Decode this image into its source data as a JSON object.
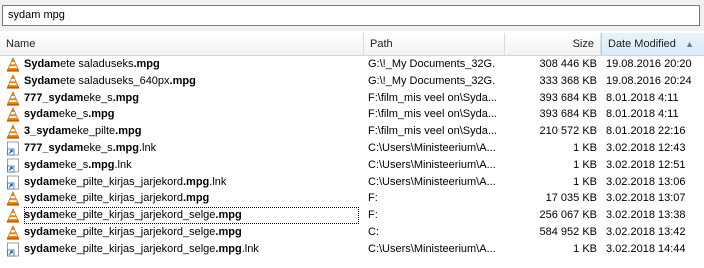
{
  "search": {
    "value": "sydam mpg"
  },
  "columns": {
    "name": "Name",
    "path": "Path",
    "size": "Size",
    "date": "Date Modified"
  },
  "rows": [
    {
      "bold": "Sydam",
      "rest": "ete saladuseks",
      "bold2": ".mpg",
      "tail": "",
      "path": "G:\\!_My Documents_32G...",
      "size": "308 446 KB",
      "date": "19.08.2016 20:20",
      "icon": "vlc-cone-icon"
    },
    {
      "bold": "Sydam",
      "rest": "ete saladuseks_640px",
      "bold2": ".mpg",
      "tail": "",
      "path": "G:\\!_My Documents_32G...",
      "size": "333 368 KB",
      "date": "19.08.2016 20:24",
      "icon": "vlc-cone-icon"
    },
    {
      "bold": "777_sydam",
      "rest": "eke_s",
      "bold2": ".mpg",
      "tail": "",
      "path": "F:\\film_mis veel on\\Syda...",
      "size": "393 684 KB",
      "date": "8.01.2018 4:11",
      "icon": "vlc-cone-icon"
    },
    {
      "bold": "sydam",
      "rest": "eke_s",
      "bold2": ".mpg",
      "tail": "",
      "path": "F:\\film_mis veel on\\Syda...",
      "size": "393 684 KB",
      "date": "8.01.2018 4:11",
      "icon": "vlc-cone-icon"
    },
    {
      "bold": "3_sydam",
      "rest": "eke_pilte",
      "bold2": ".mpg",
      "tail": "",
      "path": "F:\\film_mis veel on\\Syda...",
      "size": "210 572 KB",
      "date": "8.01.2018 22:16",
      "icon": "vlc-cone-icon"
    },
    {
      "bold": "777_sydam",
      "rest": "eke_s",
      "bold2": ".mpg",
      "tail": ".lnk",
      "path": "C:\\Users\\Ministeerium\\A...",
      "size": "1 KB",
      "date": "3.02.2018 12:43",
      "icon": "shortcut-icon"
    },
    {
      "bold": "sydam",
      "rest": "eke_s",
      "bold2": ".mpg",
      "tail": ".lnk",
      "path": "C:\\Users\\Ministeerium\\A...",
      "size": "1 KB",
      "date": "3.02.2018 12:51",
      "icon": "shortcut-icon"
    },
    {
      "bold": "sydam",
      "rest": "eke_pilte_kirjas_jarjekord",
      "bold2": ".mpg",
      "tail": ".lnk",
      "path": "C:\\Users\\Ministeerium\\A...",
      "size": "1 KB",
      "date": "3.02.2018 13:06",
      "icon": "shortcut-icon"
    },
    {
      "bold": "sydam",
      "rest": "eke_pilte_kirjas_jarjekord",
      "bold2": ".mpg",
      "tail": "",
      "path": "F:",
      "size": "17 035 KB",
      "date": "3.02.2018 13:07",
      "icon": "vlc-cone-icon"
    },
    {
      "bold": "sydam",
      "rest": "eke_pilte_kirjas_jarjekord_selge",
      "bold2": ".mpg",
      "tail": "",
      "path": "F:",
      "size": "256 067 KB",
      "date": "3.02.2018 13:38",
      "icon": "vlc-cone-icon"
    },
    {
      "bold": "sydam",
      "rest": "eke_pilte_kirjas_jarjekord_selge",
      "bold2": ".mpg",
      "tail": "",
      "path": "C:",
      "size": "584 952 KB",
      "date": "3.02.2018 13:42",
      "icon": "vlc-cone-icon"
    },
    {
      "bold": "sydam",
      "rest": "eke_pilte_kirjas_jarjekord_selge",
      "bold2": ".mpg",
      "tail": ".lnk",
      "path": "C:\\Users\\Ministeerium\\A...",
      "size": "1 KB",
      "date": "3.02.2018 14:44",
      "icon": "shortcut-icon"
    }
  ]
}
